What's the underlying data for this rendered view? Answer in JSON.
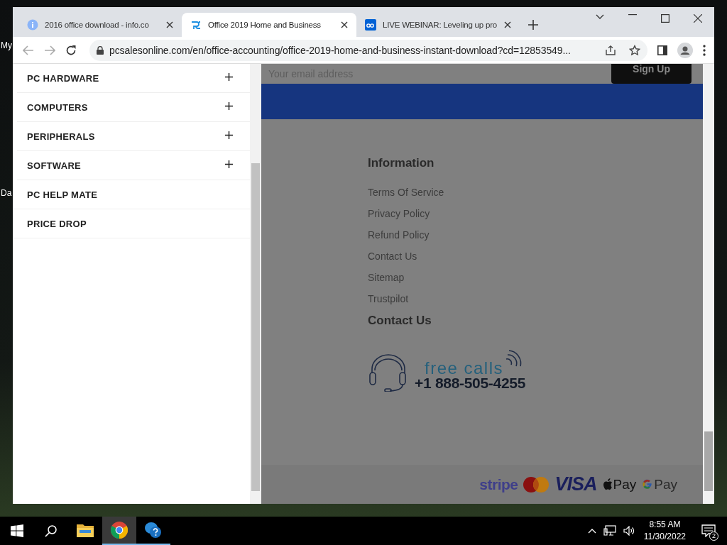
{
  "desktop_labels": [
    "My",
    "Da"
  ],
  "tabs": [
    {
      "title": "2016 office download - info.co",
      "kind": "info",
      "selected": false
    },
    {
      "title": "Office 2019 Home and Business",
      "kind": "pc",
      "selected": true
    },
    {
      "title": "LIVE WEBINAR: Leveling up pro",
      "kind": "box",
      "selected": false
    }
  ],
  "address_bar": {
    "url": "pcsalesonline.com/en/office-accounting/office-2019-home-and-business-instant-download?cd=12853549..."
  },
  "menu_drawer": {
    "items": [
      {
        "label": "PC HARDWARE",
        "expandable": true
      },
      {
        "label": "COMPUTERS",
        "expandable": true
      },
      {
        "label": "PERIPHERALS",
        "expandable": true
      },
      {
        "label": "SOFTWARE",
        "expandable": true
      },
      {
        "label": "PC HELP MATE",
        "expandable": false
      },
      {
        "label": "PRICE DROP",
        "expandable": false
      }
    ]
  },
  "newsletter": {
    "placeholder": "Your email address",
    "button": "Sign Up"
  },
  "footer": {
    "information_heading": "Information",
    "links": [
      "Terms Of Service",
      "Privacy Policy",
      "Refund Policy",
      "Contact Us",
      "Sitemap",
      "Trustpilot"
    ],
    "contact_heading": "Contact Us",
    "free_calls": "free calls",
    "phone": "+1 888-505-4255",
    "payments": [
      {
        "kind": "stripe",
        "text": "stripe"
      },
      {
        "kind": "mastercard"
      },
      {
        "kind": "visa",
        "text": "VISA"
      },
      {
        "kind": "applepay",
        "text": "Pay"
      },
      {
        "kind": "googlepay",
        "text": "Pay"
      }
    ]
  },
  "taskbar": {
    "time": "8:55 AM",
    "date": "11/30/2022",
    "notification_count": "2"
  }
}
